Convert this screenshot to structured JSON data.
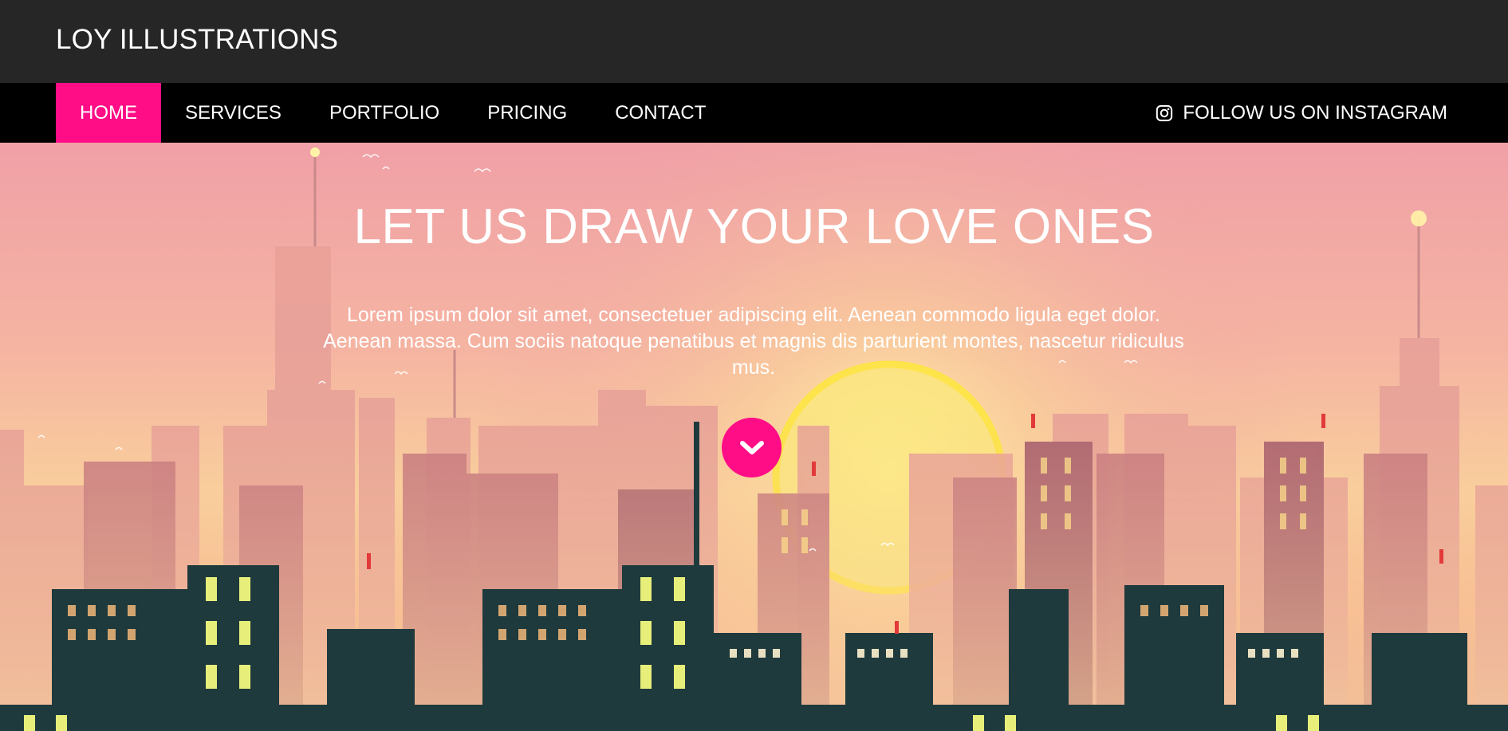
{
  "brand": {
    "title": "LOY ILLUSTRATIONS"
  },
  "nav": {
    "items": [
      {
        "label": "HOME",
        "active": true
      },
      {
        "label": "SERVICES",
        "active": false
      },
      {
        "label": "PORTFOLIO",
        "active": false
      },
      {
        "label": "PRICING",
        "active": false
      },
      {
        "label": "CONTACT",
        "active": false
      }
    ],
    "instagram": {
      "label": "FOLLOW US ON INSTAGRAM",
      "icon": "instagram-icon"
    }
  },
  "hero": {
    "title": "LET US DRAW YOUR LOVE ONES",
    "text": "Lorem ipsum dolor sit amet, consectetuer adipiscing elit. Aenean commodo ligula eget dolor. Aenean massa. Cum sociis natoque penatibus et magnis dis parturient montes, nascetur ridiculus mus.",
    "scroll_icon": "chevron-down-icon"
  },
  "colors": {
    "accent": "#ff0d86",
    "topbar": "#262626",
    "navbar": "#000000",
    "sky_top": "#f0a0a6",
    "sun": "#fbe87a"
  }
}
